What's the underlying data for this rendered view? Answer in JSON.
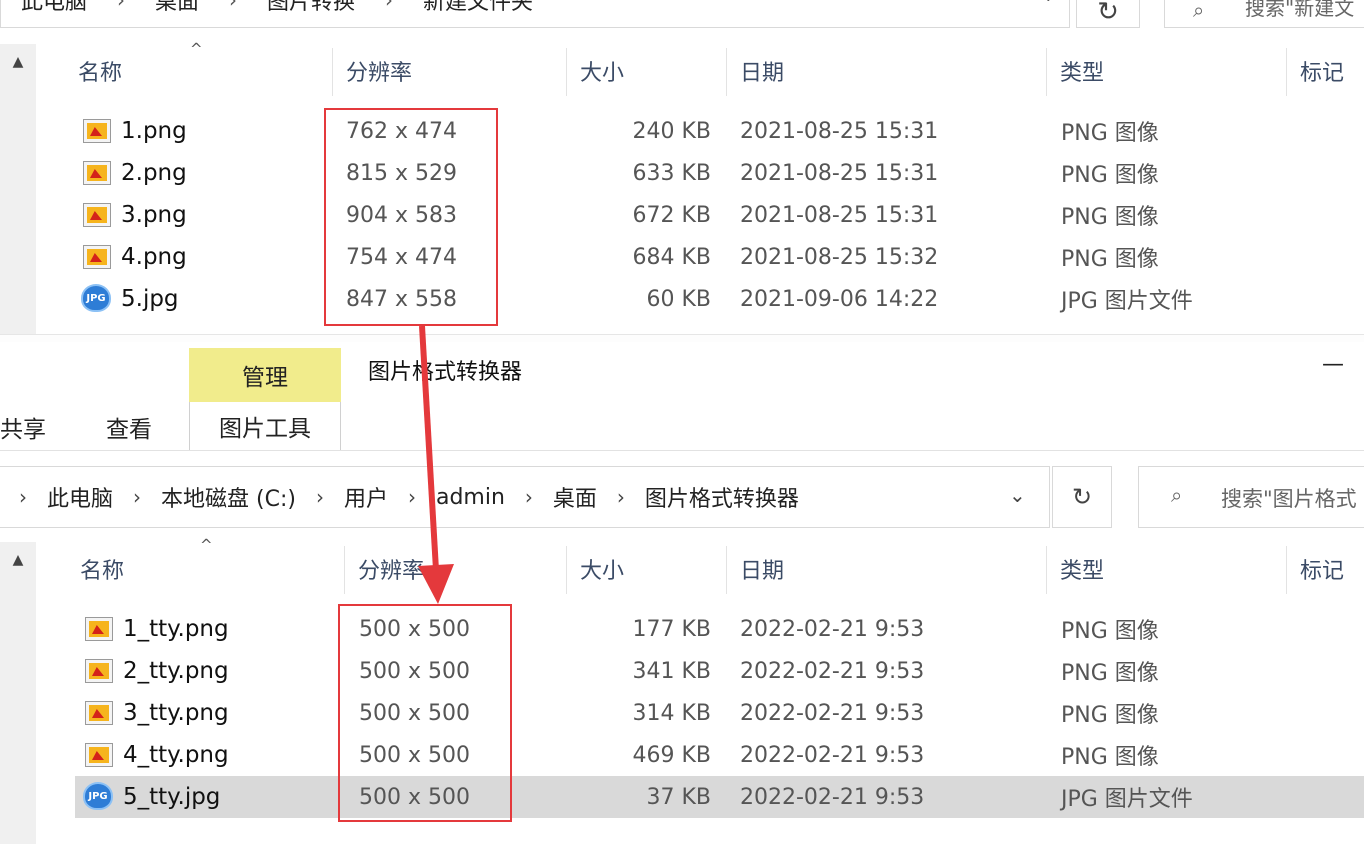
{
  "top_window": {
    "breadcrumb": [
      "此电脑",
      "桌面",
      "图片转换",
      "新建文件夹"
    ],
    "search_placeholder": "搜索\"新建文",
    "columns": [
      "名称",
      "分辨率",
      "大小",
      "日期",
      "类型",
      "标记"
    ],
    "files": [
      {
        "name": "1.png",
        "resolution": "762 x 474",
        "size": "240 KB",
        "date": "2021-08-25 15:31",
        "type": "PNG 图像",
        "icon": "png-file-icon"
      },
      {
        "name": "2.png",
        "resolution": "815 x 529",
        "size": "633 KB",
        "date": "2021-08-25 15:31",
        "type": "PNG 图像",
        "icon": "png-file-icon"
      },
      {
        "name": "3.png",
        "resolution": "904 x 583",
        "size": "672 KB",
        "date": "2021-08-25 15:31",
        "type": "PNG 图像",
        "icon": "png-file-icon"
      },
      {
        "name": "4.png",
        "resolution": "754 x 474",
        "size": "684 KB",
        "date": "2021-08-25 15:32",
        "type": "PNG 图像",
        "icon": "png-file-icon"
      },
      {
        "name": "5.jpg",
        "resolution": "847 x 558",
        "size": "60 KB",
        "date": "2021-09-06 14:22",
        "type": "JPG 图片文件",
        "icon": "jpg-file-icon"
      }
    ]
  },
  "bottom_window": {
    "ribbon": {
      "context_tab_group": "管理",
      "context_tab": "图片工具",
      "tab_share": "共享",
      "tab_view": "查看"
    },
    "title": "图片格式转换器",
    "minimize_glyph": "—",
    "breadcrumb": [
      "此电脑",
      "本地磁盘 (C:)",
      "用户",
      "admin",
      "桌面",
      "图片格式转换器"
    ],
    "search_placeholder": "搜索\"图片格式",
    "columns": [
      "名称",
      "分辨率",
      "大小",
      "日期",
      "类型",
      "标记"
    ],
    "files": [
      {
        "name": "1_tty.png",
        "resolution": "500 x 500",
        "size": "177 KB",
        "date": "2022-02-21 9:53",
        "type": "PNG 图像",
        "icon": "png-file-icon"
      },
      {
        "name": "2_tty.png",
        "resolution": "500 x 500",
        "size": "341 KB",
        "date": "2022-02-21 9:53",
        "type": "PNG 图像",
        "icon": "png-file-icon"
      },
      {
        "name": "3_tty.png",
        "resolution": "500 x 500",
        "size": "314 KB",
        "date": "2022-02-21 9:53",
        "type": "PNG 图像",
        "icon": "png-file-icon"
      },
      {
        "name": "4_tty.png",
        "resolution": "500 x 500",
        "size": "469 KB",
        "date": "2022-02-21 9:53",
        "type": "PNG 图像",
        "icon": "png-file-icon"
      },
      {
        "name": "5_tty.jpg",
        "resolution": "500 x 500",
        "size": "37 KB",
        "date": "2022-02-21 9:53",
        "type": "JPG 图片文件",
        "icon": "jpg-file-icon",
        "selected": true
      }
    ]
  },
  "icons": {
    "sort_caret": "^",
    "chevron_down": "⌄",
    "refresh": "↻",
    "search": "⌕",
    "scroll_up": "▲",
    "breadcrumb_sep": "›",
    "jpg_badge": "JPG"
  },
  "colors": {
    "highlight_box": "#e4393c",
    "arrow": "#e4393c",
    "manage_tab": "#f1ec8c",
    "selected_row": "#d9d9d9"
  }
}
